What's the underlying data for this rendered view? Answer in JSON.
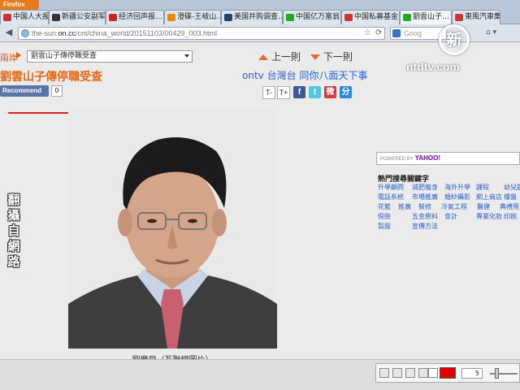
{
  "browser": {
    "app_button": "Firefox",
    "tabs": [
      {
        "label": "中国人大报告…",
        "color": "#c33"
      },
      {
        "label": "新疆公安副军…",
        "color": "#333"
      },
      {
        "label": "经济回声报…",
        "color": "#c22"
      },
      {
        "label": "澄碟-王岐山…",
        "color": "#e80"
      },
      {
        "label": "美国并购调查…",
        "color": "#246"
      },
      {
        "label": "中国亿万富翁…",
        "color": "#2a2"
      },
      {
        "label": "中国私募基金…",
        "color": "#c33"
      },
      {
        "label": "劉雲山子…",
        "color": "#2a2"
      },
      {
        "label": "東風汽車集…",
        "color": "#c33"
      }
    ],
    "url_prefix": "the-sun.",
    "url_domain": "on.cc",
    "url_path": "/cnt/china_world/20151103/00429_003.html",
    "search_placeholder": "Goog",
    "nav_back": "◀",
    "nav_star": "☆",
    "nav_refresh": "⟳",
    "nav_tools": "⌂ ▾"
  },
  "page": {
    "crumb": "兩岸",
    "select_value": "劉雲山子傳停職受查",
    "prev_label": "上一則",
    "next_label": "下一則",
    "headline": "劉雲山子傳停職受查",
    "ontv_text": "ontv 台灣台 同你八面天下事",
    "recommend_label": "Recommend",
    "recommend_count": "0",
    "text_smaller": "T-",
    "text_larger": "T+",
    "share": [
      {
        "icon": "facebook-icon",
        "glyph": "f",
        "color": "#3b5998"
      },
      {
        "icon": "twitter-icon",
        "glyph": "t",
        "color": "#55c6e0"
      },
      {
        "icon": "weibo-icon",
        "glyph": "微",
        "color": "#d9363e"
      },
      {
        "icon": "other-share-icon",
        "glyph": "分",
        "color": "#2b8bd6"
      }
    ],
    "photo_caption": "劉樂飛（互聯網圖片）",
    "side_caption": "翻攝自網路",
    "yahoo_label": "YAHOO!",
    "yahoo_powered": "POWERED BY",
    "hot_title": "熱門搜尋關鍵字",
    "keywords": [
      [
        "升學顧問",
        "減肥瘦身",
        "海外升學",
        "課程",
        "幼兒課程"
      ],
      [
        "電話系統",
        "市場推廣",
        "婚紗攝影",
        "網上商店",
        "樓盤"
      ],
      [
        "花籃",
        "推廣",
        "裝修",
        "冷氣工程",
        "醫健",
        "典禮用"
      ],
      [
        "保險",
        "五金原料",
        "會計",
        "專業化妝",
        "印刷"
      ],
      [
        "製服",
        "宣傳方法"
      ]
    ]
  },
  "overlay": {
    "logo_char": "新",
    "logo_text": "ntdtv.com"
  },
  "toolbar": {
    "size_value": "5",
    "accent_color": "#e00000"
  }
}
